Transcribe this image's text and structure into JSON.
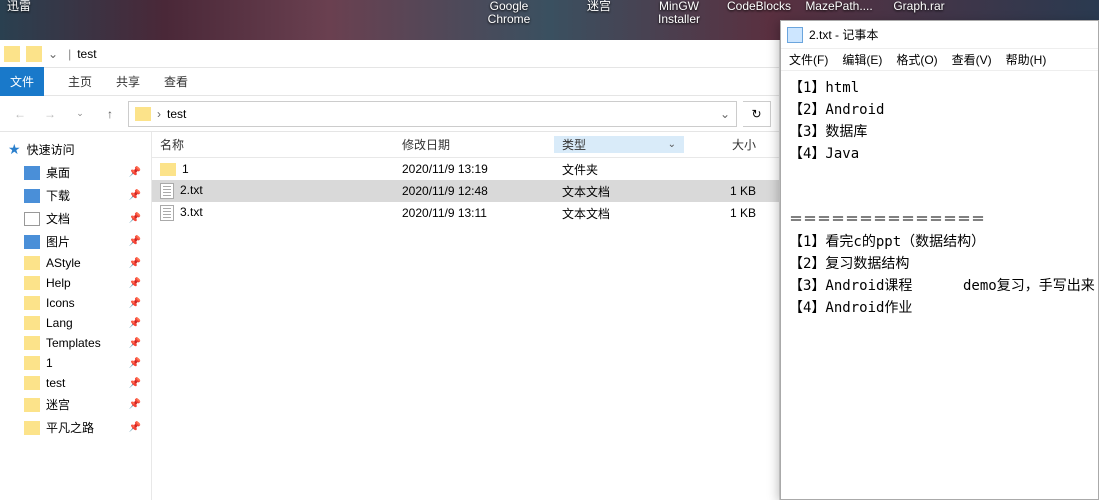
{
  "desktop": {
    "icons": [
      {
        "label1": "迅雷",
        "label2": ""
      },
      {
        "label1": "Google",
        "label2": "Chrome"
      },
      {
        "label1": "迷宫",
        "label2": ""
      },
      {
        "label1": "MinGW",
        "label2": "Installer"
      },
      {
        "label1": "CodeBlocks",
        "label2": ""
      },
      {
        "label1": "MazePath....",
        "label2": ""
      },
      {
        "label1": "Graph.rar",
        "label2": ""
      }
    ]
  },
  "explorer": {
    "title_text": "test",
    "ribbon": {
      "file": "文件",
      "home": "主页",
      "share": "共享",
      "view": "查看"
    },
    "address": {
      "folder": "test",
      "chevron": "›"
    },
    "columns": {
      "name": "名称",
      "date": "修改日期",
      "type": "类型",
      "size": "大小"
    },
    "rows": [
      {
        "name": "1",
        "date": "2020/11/9 13:19",
        "type": "文件夹",
        "size": "",
        "kind": "folder"
      },
      {
        "name": "2.txt",
        "date": "2020/11/9 12:48",
        "type": "文本文档",
        "size": "1 KB",
        "kind": "txt",
        "selected": true
      },
      {
        "name": "3.txt",
        "date": "2020/11/9 13:11",
        "type": "文本文档",
        "size": "1 KB",
        "kind": "txt"
      }
    ],
    "sidebar": {
      "head": "快速访问",
      "items": [
        {
          "label": "桌面",
          "icon": "blue"
        },
        {
          "label": "下载",
          "icon": "blue"
        },
        {
          "label": "文档",
          "icon": "doc"
        },
        {
          "label": "图片",
          "icon": "blue"
        },
        {
          "label": "AStyle",
          "icon": "folder"
        },
        {
          "label": "Help",
          "icon": "folder"
        },
        {
          "label": "Icons",
          "icon": "folder"
        },
        {
          "label": "Lang",
          "icon": "folder"
        },
        {
          "label": "Templates",
          "icon": "folder"
        },
        {
          "label": "1",
          "icon": "folder"
        },
        {
          "label": "test",
          "icon": "folder"
        },
        {
          "label": "迷宫",
          "icon": "folder"
        },
        {
          "label": "平凡之路",
          "icon": "folder"
        }
      ]
    }
  },
  "notepad": {
    "title": "2.txt - 记事本",
    "menu": {
      "file": "文件(F)",
      "edit": "编辑(E)",
      "format": "格式(O)",
      "view": "查看(V)",
      "help": "帮助(H)"
    },
    "content": "【1】html\n【2】Android\n【3】数据库\n【4】Java\n\n\n＝＝＝＝＝＝＝＝＝＝＝＝＝＝\n【1】看完c的ppt（数据结构）\n【2】复习数据结构\n【3】Android课程      demo复习，手写出来\n【4】Android作业"
  }
}
